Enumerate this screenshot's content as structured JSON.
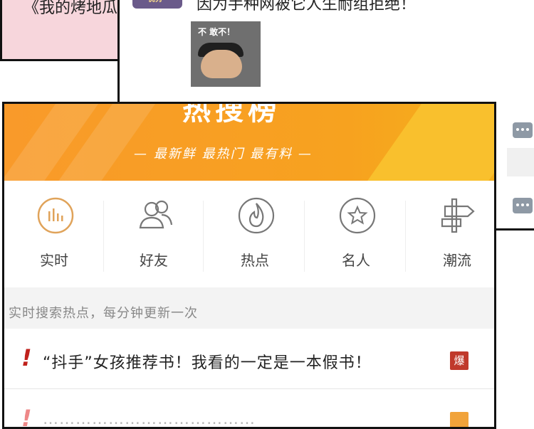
{
  "background": {
    "pink_panel_text": "《我的烤地瓜",
    "chat_text": "因为手种网被它人生耐组拒绝！",
    "avatar_text": "优秀",
    "meme_text": "不 敢不！"
  },
  "banner": {
    "title": "热搜榜",
    "slogan": "— 最新鲜  最热门  最有料 —"
  },
  "nav": [
    {
      "label": "实时",
      "icon": "chart-icon"
    },
    {
      "label": "好友",
      "icon": "friends-icon"
    },
    {
      "label": "热点",
      "icon": "flame-icon"
    },
    {
      "label": "名人",
      "icon": "star-icon"
    },
    {
      "label": "潮流",
      "icon": "signpost-icon"
    }
  ],
  "hint": "实时搜索热点，每分钟更新一次",
  "list": [
    {
      "title": "“抖手”女孩推荐书！我看的一定是一本假书！",
      "badge": "爆"
    },
    {
      "title": "…………………………………",
      "badge": ""
    }
  ],
  "colors": {
    "accent": "#f99a2a",
    "hot_badge": "#c0392b",
    "icon_outline": "#e0a35a"
  }
}
